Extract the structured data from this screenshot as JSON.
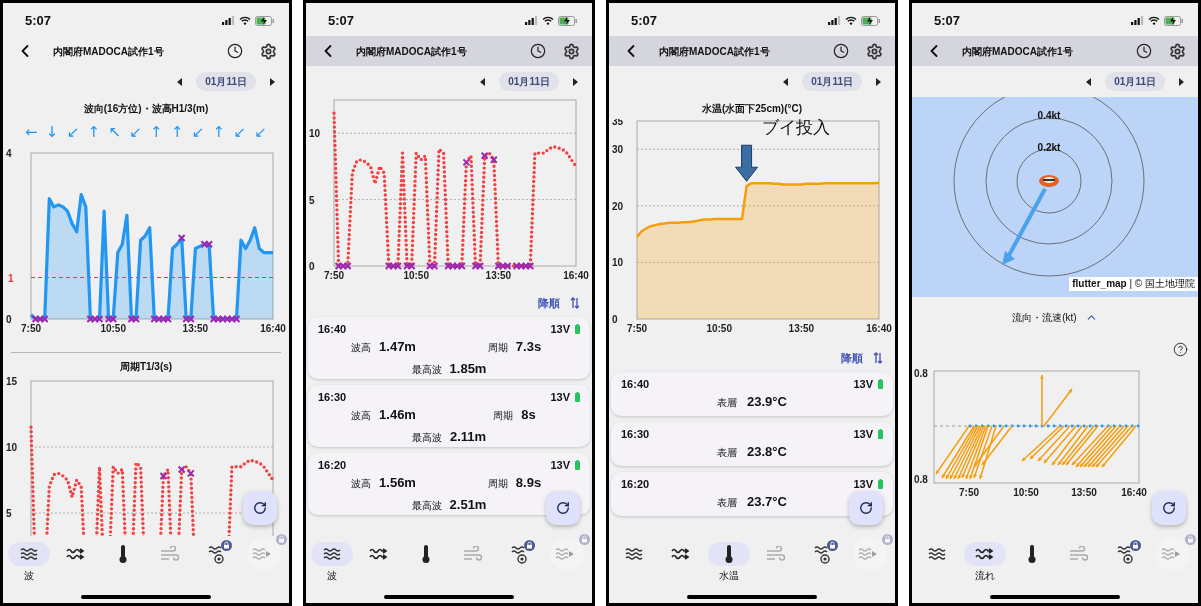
{
  "phones": [
    {
      "status_time": "5:07",
      "title": "内閣府MADOCA試作1号",
      "date": "01月11日",
      "scrolled": false,
      "content": [
        {
          "kind": "heading",
          "text": "波向(16方位)・波高H1/3(m)"
        },
        {
          "kind": "arrows",
          "arrows": [
            "←",
            "↓",
            "↙",
            "↑",
            "↖",
            "↙",
            "↑",
            "↑",
            "↙",
            "↑",
            "↙",
            "↙"
          ]
        },
        {
          "kind": "chart",
          "chart_data": {
            "type": "area",
            "x": [
              470,
              480,
              490,
              500,
              510,
              520,
              530,
              540,
              550,
              560,
              570,
              580,
              590,
              600,
              610,
              620,
              630,
              640,
              650,
              660,
              670,
              680,
              690,
              700,
              710,
              720,
              730,
              740,
              750,
              760,
              770,
              780,
              790,
              800,
              810,
              820,
              830,
              840,
              850,
              860,
              870,
              880,
              890,
              900,
              910,
              920,
              930,
              940,
              950,
              960,
              970,
              980,
              990,
              1000
            ],
            "series": [
              {
                "color": "#2196f3",
                "values": [
                  0.1,
                  0,
                  0,
                  0,
                  2.9,
                  2.7,
                  2.75,
                  2.7,
                  2.6,
                  2.3,
                  2.1,
                  3.0,
                  2.7,
                  0,
                  0,
                  0,
                  2.6,
                  0,
                  0,
                  1.6,
                  1.8,
                  2.5,
                  0,
                  0,
                  1.9,
                  2.0,
                  2.2,
                  0,
                  0,
                  0,
                  0,
                  1.7,
                  1.8,
                  1.95,
                  0,
                  0,
                  1.7,
                  1.75,
                  1.8,
                  1.8,
                  0,
                  0,
                  0,
                  0,
                  0,
                  0,
                  1.9,
                  1.7,
                  1.9,
                  2.2,
                  1.7,
                  1.6,
                  1.6,
                  1.6
                ]
              },
              {
                "type": "scatter",
                "color": "#9c27b0",
                "values": [
                  null,
                  0,
                  0,
                  0,
                  null,
                  null,
                  null,
                  null,
                  null,
                  null,
                  null,
                  null,
                  null,
                  0,
                  0,
                  0,
                  null,
                  0,
                  0,
                  null,
                  null,
                  null,
                  0,
                  0,
                  null,
                  null,
                  null,
                  0,
                  0,
                  0,
                  0,
                  null,
                  null,
                  1.95,
                  0,
                  0,
                  null,
                  null,
                  1.8,
                  1.8,
                  0,
                  0,
                  0,
                  0,
                  0,
                  0,
                  null,
                  null,
                  null,
                  null,
                  null,
                  null,
                  null,
                  null
                ]
              }
            ],
            "xlim": [
              470,
              1000
            ],
            "ylim": [
              0,
              4
            ],
            "yticks": [
              0,
              4
            ],
            "xticks": [
              {
                "value": 470,
                "label": "7:50"
              },
              {
                "value": 650,
                "label": "10:50"
              },
              {
                "value": 830,
                "label": "13:50"
              },
              {
                "value": 1000,
                "label": "16:40"
              }
            ],
            "ref_lines": [
              {
                "axis": "y",
                "value": 1,
                "label": "1",
                "color": "#e53935"
              }
            ]
          }
        },
        {
          "kind": "divider"
        },
        {
          "kind": "heading",
          "text": "周期T1/3(s)"
        },
        {
          "kind": "chart",
          "chart_data": {
            "type": "line",
            "grid": true,
            "x": [
              470,
              480,
              500,
              510,
              520,
              530,
              540,
              550,
              560,
              570,
              580,
              590,
              610,
              620,
              630,
              640,
              650,
              660,
              670,
              680,
              690,
              700,
              710,
              720,
              750,
              760,
              770,
              780,
              790,
              800,
              810,
              820,
              830,
              900,
              910,
              920,
              930,
              940,
              950,
              960,
              970,
              980,
              990,
              1000
            ],
            "series": [
              {
                "color": "#ef4444",
                "line_style": "dotted",
                "values": [
                  11.5,
                  0,
                  0,
                  7,
                  7.9,
                  8,
                  7.8,
                  7.5,
                  6.2,
                  7.5,
                  7,
                  0,
                  0,
                  8.5,
                  0,
                  0,
                  8.5,
                  8,
                  8.3,
                  0,
                  0,
                  8.8,
                  8.5,
                  0,
                  0,
                  7.8,
                  8.3,
                  0,
                  0,
                  8.3,
                  8.5,
                  8,
                  0,
                  0,
                  8.5,
                  8.5,
                  8.5,
                  8.8,
                  9,
                  8.9,
                  8.8,
                  8.5,
                  8,
                  7.5
                ]
              },
              {
                "type": "scatter",
                "color": "#9c27b0",
                "values": [
                  null,
                  null,
                  null,
                  null,
                  null,
                  null,
                  null,
                  null,
                  null,
                  null,
                  null,
                  null,
                  null,
                  null,
                  null,
                  null,
                  null,
                  null,
                  null,
                  null,
                  null,
                  null,
                  null,
                  null,
                  null,
                  7.8,
                  null,
                  null,
                  null,
                  8.3,
                  null,
                  8,
                  null,
                  null,
                  null,
                  null,
                  null,
                  null,
                  null,
                  null,
                  null,
                  null,
                  null,
                  null
                ]
              }
            ],
            "xlim": [
              470,
              1000
            ],
            "ylim": [
              0,
              15
            ],
            "yticks": [
              5,
              10,
              15
            ]
          }
        }
      ],
      "nav": [
        {
          "kind": "waves",
          "selected": true,
          "label": "波",
          "disabled": false,
          "locked": false
        },
        {
          "kind": "current",
          "selected": false,
          "disabled": false,
          "locked": false
        },
        {
          "kind": "thermometer",
          "selected": false,
          "disabled": false,
          "locked": false
        },
        {
          "kind": "wind",
          "selected": false,
          "disabled": true,
          "locked": false
        },
        {
          "kind": "station",
          "selected": false,
          "disabled": false,
          "locked": true
        },
        {
          "kind": "replay",
          "selected": false,
          "disabled": true,
          "locked": true
        }
      ]
    },
    {
      "status_time": "5:07",
      "title": "内閣府MADOCA試作1号",
      "date": "01月11日",
      "scrolled": true,
      "content": [
        {
          "kind": "chart",
          "chart_data": {
            "type": "line",
            "grid": true,
            "x": [
              470,
              480,
              490,
              500,
              510,
              520,
              530,
              540,
              550,
              560,
              570,
              580,
              590,
              600,
              610,
              620,
              630,
              640,
              650,
              660,
              670,
              680,
              690,
              700,
              710,
              720,
              730,
              740,
              750,
              760,
              770,
              780,
              790,
              800,
              810,
              820,
              830,
              840,
              850,
              860,
              870,
              880,
              890,
              900,
              910,
              920,
              930,
              940,
              950,
              960,
              970,
              980,
              990,
              1000
            ],
            "series": [
              {
                "color": "#ef4444",
                "line_style": "dotted",
                "values": [
                  11.5,
                  0,
                  0,
                  0,
                  7,
                  7.9,
                  8,
                  7.8,
                  7.5,
                  6.2,
                  7.5,
                  7,
                  0,
                  0,
                  0,
                  8.5,
                  0,
                  0,
                  8.5,
                  8,
                  8.3,
                  0,
                  0,
                  8.8,
                  8.5,
                  0,
                  0,
                  0,
                  0,
                  7.8,
                  8.3,
                  0,
                  0,
                  8.3,
                  8.5,
                  8,
                  0,
                  0,
                  0,
                  0,
                  0,
                  0,
                  0,
                  0,
                  8.5,
                  8.5,
                  8.5,
                  8.8,
                  9,
                  8.9,
                  8.8,
                  8.5,
                  8,
                  7.5
                ]
              },
              {
                "type": "scatter",
                "color": "#9c27b0",
                "values": [
                  null,
                  0,
                  0,
                  0,
                  null,
                  null,
                  null,
                  null,
                  null,
                  null,
                  null,
                  null,
                  0,
                  0,
                  0,
                  null,
                  0,
                  0,
                  null,
                  null,
                  null,
                  0,
                  0,
                  null,
                  null,
                  0,
                  0,
                  0,
                  0,
                  7.8,
                  null,
                  0,
                  0,
                  8.3,
                  null,
                  8,
                  0,
                  0,
                  0,
                  null,
                  0,
                  0,
                  0,
                  0,
                  null,
                  null,
                  null,
                  null,
                  null,
                  null,
                  null,
                  null,
                  null,
                  null
                ]
              }
            ],
            "xlim": [
              470,
              1000
            ],
            "ylim": [
              0,
              12.5
            ],
            "yticks": [
              0,
              5,
              10
            ],
            "xticks": [
              {
                "value": 470,
                "label": "7:50"
              },
              {
                "value": 650,
                "label": "10:50"
              },
              {
                "value": 830,
                "label": "13:50"
              },
              {
                "value": 1000,
                "label": "16:40"
              }
            ]
          }
        },
        {
          "kind": "cards",
          "sort_label": "降順",
          "items": [
            {
              "time": "16:40",
              "voltage": "13V",
              "readings": [
                {
                  "label": "波高",
                  "value": "1.47m"
                },
                {
                  "label": "周期",
                  "value": "7.3s"
                },
                {
                  "label": "最高波",
                  "value": "1.85m"
                }
              ]
            },
            {
              "time": "16:30",
              "voltage": "13V",
              "readings": [
                {
                  "label": "波高",
                  "value": "1.46m"
                },
                {
                  "label": "周期",
                  "value": "8s"
                },
                {
                  "label": "最高波",
                  "value": "2.11m"
                }
              ]
            },
            {
              "time": "16:20",
              "voltage": "13V",
              "readings": [
                {
                  "label": "波高",
                  "value": "1.56m"
                },
                {
                  "label": "周期",
                  "value": "8.9s"
                },
                {
                  "label": "最高波",
                  "value": "2.51m"
                }
              ]
            }
          ]
        }
      ],
      "nav": [
        {
          "kind": "waves",
          "selected": true,
          "label": "波",
          "disabled": false,
          "locked": false
        },
        {
          "kind": "current",
          "selected": false,
          "disabled": false,
          "locked": false
        },
        {
          "kind": "thermometer",
          "selected": false,
          "disabled": false,
          "locked": false
        },
        {
          "kind": "wind",
          "selected": false,
          "disabled": true,
          "locked": false
        },
        {
          "kind": "station",
          "selected": false,
          "disabled": false,
          "locked": true
        },
        {
          "kind": "replay",
          "selected": false,
          "disabled": true,
          "locked": true
        }
      ]
    },
    {
      "status_time": "5:07",
      "title": "内閣府MADOCA試作1号",
      "date": "01月11日",
      "scrolled": true,
      "content": [
        {
          "kind": "heading",
          "text": "水温(水面下25cm)(°C)"
        },
        {
          "kind": "chart",
          "chart_data": {
            "type": "area",
            "grid": true,
            "x": [
              470,
              480,
              490,
              500,
              510,
              520,
              530,
              540,
              550,
              560,
              570,
              580,
              590,
              600,
              610,
              620,
              630,
              640,
              650,
              660,
              670,
              680,
              690,
              700,
              710,
              720,
              730,
              740,
              750,
              760,
              770,
              780,
              790,
              800,
              810,
              820,
              830,
              840,
              850,
              860,
              870,
              880,
              890,
              900,
              910,
              920,
              930,
              940,
              950,
              960,
              970,
              980,
              990,
              1000
            ],
            "series": [
              {
                "color": "#f59e0b",
                "values": [
                  14.5,
                  15.5,
                  16,
                  16.4,
                  16.6,
                  16.8,
                  16.9,
                  17,
                  17,
                  17,
                  17.1,
                  17.1,
                  17.2,
                  17.3,
                  17.5,
                  17.6,
                  17.6,
                  17.7,
                  17.7,
                  17.7,
                  17.7,
                  17.7,
                  17.7,
                  17.7,
                  23.5,
                  24,
                  24,
                  24,
                  24,
                  24,
                  23.9,
                  23.9,
                  23.8,
                  23.8,
                  23.8,
                  23.8,
                  23.8,
                  23.9,
                  23.9,
                  23.9,
                  23.9,
                  24,
                  24,
                  24,
                  24,
                  24,
                  24,
                  24,
                  24,
                  24,
                  24,
                  24,
                  24,
                  24.1
                ]
              }
            ],
            "xlim": [
              470,
              1000
            ],
            "ylim": [
              0,
              35
            ],
            "yticks": [
              0,
              10,
              20,
              30,
              35
            ],
            "xticks": [
              {
                "value": 470,
                "label": "7:50"
              },
              {
                "value": 650,
                "label": "10:50"
              },
              {
                "value": 830,
                "label": "13:50"
              },
              {
                "value": 1000,
                "label": "16:40"
              }
            ],
            "annotations": [
              {
                "x": 710,
                "y": 24,
                "text": "ブイ投入"
              }
            ]
          }
        },
        {
          "kind": "cards",
          "sort_label": "降順",
          "items": [
            {
              "time": "16:40",
              "voltage": "13V",
              "readings": [
                {
                  "label": "表層",
                  "value": "23.9°C"
                }
              ]
            },
            {
              "time": "16:30",
              "voltage": "13V",
              "readings": [
                {
                  "label": "表層",
                  "value": "23.8°C"
                }
              ]
            },
            {
              "time": "16:20",
              "voltage": "13V",
              "readings": [
                {
                  "label": "表層",
                  "value": "23.7°C"
                }
              ]
            }
          ]
        }
      ],
      "nav": [
        {
          "kind": "waves",
          "selected": false,
          "disabled": false,
          "locked": false
        },
        {
          "kind": "current",
          "selected": false,
          "disabled": false,
          "locked": false
        },
        {
          "kind": "thermometer",
          "selected": true,
          "label": "水温",
          "disabled": false,
          "locked": false
        },
        {
          "kind": "wind",
          "selected": false,
          "disabled": true,
          "locked": false
        },
        {
          "kind": "station",
          "selected": false,
          "disabled": false,
          "locked": true
        },
        {
          "kind": "replay",
          "selected": false,
          "disabled": true,
          "locked": true
        }
      ]
    },
    {
      "status_time": "5:07",
      "title": "内閣府MADOCA試作1号",
      "date": "01月11日",
      "scrolled": true,
      "content": [
        {
          "kind": "map",
          "ring_labels": [
            "0.4kt",
            "0.2kt"
          ],
          "attribution": "**flutter_map** | © 国土地理院"
        },
        {
          "kind": "toggle",
          "text": "流向・流速(kt)",
          "expanded": true
        },
        {
          "kind": "vector_plot",
          "y_labels": [
            "0.8",
            "0.8"
          ],
          "x_labels": [
            "7:50",
            "10:50",
            "13:50",
            "16:40"
          ]
        }
      ],
      "nav": [
        {
          "kind": "waves",
          "selected": false,
          "disabled": false,
          "locked": false
        },
        {
          "kind": "current",
          "selected": true,
          "label": "流れ",
          "disabled": false,
          "locked": false
        },
        {
          "kind": "thermometer",
          "selected": false,
          "disabled": false,
          "locked": false
        },
        {
          "kind": "wind",
          "selected": false,
          "disabled": true,
          "locked": false
        },
        {
          "kind": "station",
          "selected": false,
          "disabled": false,
          "locked": true
        },
        {
          "kind": "replay",
          "selected": false,
          "disabled": true,
          "locked": true
        }
      ]
    }
  ]
}
